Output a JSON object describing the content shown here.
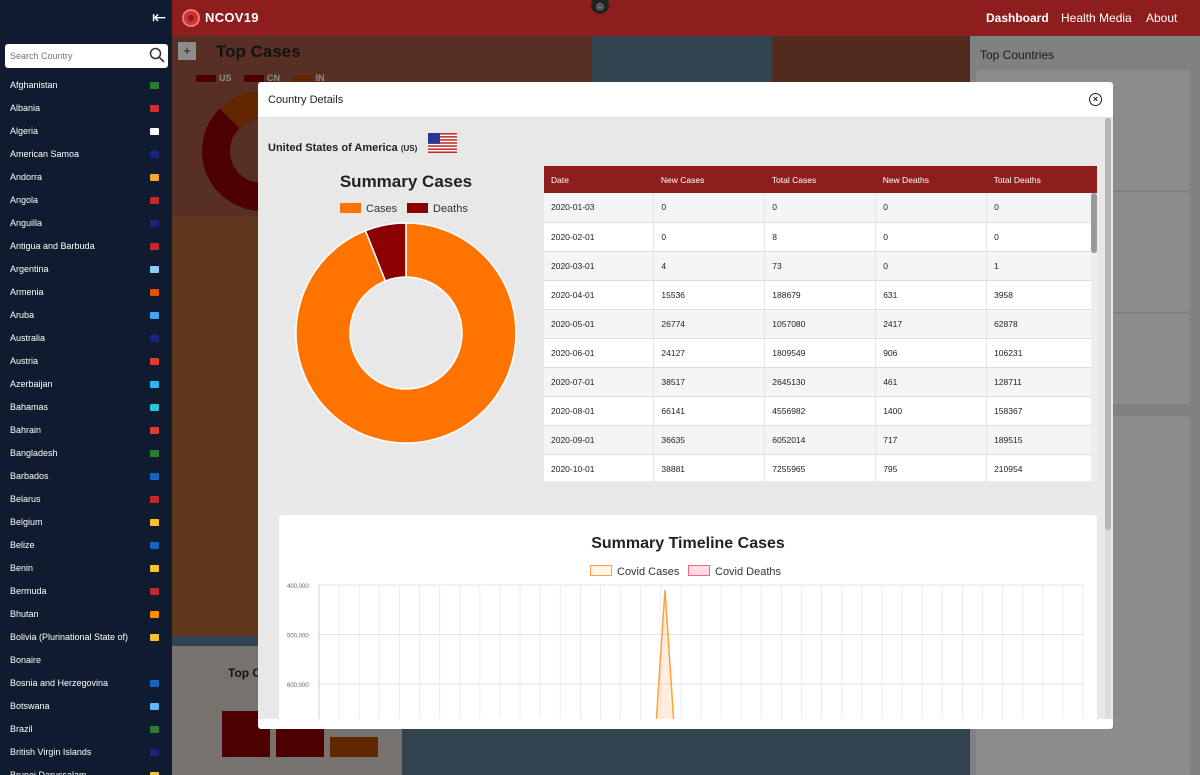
{
  "app": {
    "brand": "NCOV19",
    "nav": {
      "dashboard": "Dashboard",
      "health_media": "Health Media",
      "about": "About"
    }
  },
  "sidebar": {
    "search_placeholder": "Search Country",
    "countries": [
      {
        "name": "Afghanistan",
        "flag": "#2e7d32"
      },
      {
        "name": "Albania",
        "flag": "#d32f2f"
      },
      {
        "name": "Algeria",
        "flag": "#ffffff"
      },
      {
        "name": "American Samoa",
        "flag": "#1a237e"
      },
      {
        "name": "Andorra",
        "flag": "#f9a825"
      },
      {
        "name": "Angola",
        "flag": "#c62828"
      },
      {
        "name": "Anguilla",
        "flag": "#1a237e"
      },
      {
        "name": "Antigua and Barbuda",
        "flag": "#c62828"
      },
      {
        "name": "Argentina",
        "flag": "#90caf9"
      },
      {
        "name": "Armenia",
        "flag": "#e65100"
      },
      {
        "name": "Aruba",
        "flag": "#42a5f5"
      },
      {
        "name": "Australia",
        "flag": "#1a237e"
      },
      {
        "name": "Austria",
        "flag": "#e53935"
      },
      {
        "name": "Azerbaijan",
        "flag": "#29b6f6"
      },
      {
        "name": "Bahamas",
        "flag": "#26c6da"
      },
      {
        "name": "Bahrain",
        "flag": "#e53935"
      },
      {
        "name": "Bangladesh",
        "flag": "#2e7d32"
      },
      {
        "name": "Barbados",
        "flag": "#1565c0"
      },
      {
        "name": "Belarus",
        "flag": "#c62828"
      },
      {
        "name": "Belgium",
        "flag": "#fbc02d"
      },
      {
        "name": "Belize",
        "flag": "#1565c0"
      },
      {
        "name": "Benin",
        "flag": "#fbc02d"
      },
      {
        "name": "Bermuda",
        "flag": "#c62828"
      },
      {
        "name": "Bhutan",
        "flag": "#ff8f00"
      },
      {
        "name": "Bolivia (Plurinational State of)",
        "flag": "#fbc02d"
      },
      {
        "name": "Bonaire",
        "flag": ""
      },
      {
        "name": "Bosnia and Herzegovina",
        "flag": "#1565c0"
      },
      {
        "name": "Botswana",
        "flag": "#64b5f6"
      },
      {
        "name": "Brazil",
        "flag": "#2e7d32"
      },
      {
        "name": "British Virgin Islands",
        "flag": "#1a237e"
      },
      {
        "name": "Brunei Darussalam",
        "flag": "#fbc02d"
      }
    ]
  },
  "background": {
    "map_zoom_in": "+",
    "top_cases_title": "Top Cases",
    "legend": [
      "US",
      "CN",
      "IN"
    ],
    "right_panel_title": "Top Countries",
    "bottom_card_title": "Top C"
  },
  "modal": {
    "title": "Country Details",
    "country_name": "United States of America",
    "country_code": "(US)",
    "summary_title": "Summary Cases",
    "legend": [
      {
        "label": "Cases",
        "color": "#ff7400"
      },
      {
        "label": "Deaths",
        "color": "#8b0000"
      }
    ],
    "table": {
      "headers": [
        "Date",
        "New Cases",
        "Total Cases",
        "New Deaths",
        "Total Deaths"
      ],
      "rows": [
        [
          "2020-01-03",
          "0",
          "0",
          "0",
          "0"
        ],
        [
          "2020-02-01",
          "0",
          "8",
          "0",
          "0"
        ],
        [
          "2020-03-01",
          "4",
          "73",
          "0",
          "1"
        ],
        [
          "2020-04-01",
          "15536",
          "188679",
          "631",
          "3958"
        ],
        [
          "2020-05-01",
          "26774",
          "1057080",
          "2417",
          "62878"
        ],
        [
          "2020-06-01",
          "24127",
          "1809549",
          "906",
          "106231"
        ],
        [
          "2020-07-01",
          "38517",
          "2645130",
          "461",
          "128711"
        ],
        [
          "2020-08-01",
          "66141",
          "4556982",
          "1400",
          "158367"
        ],
        [
          "2020-09-01",
          "36635",
          "6052014",
          "717",
          "189515"
        ],
        [
          "2020-10-01",
          "38881",
          "7255965",
          "795",
          "210954"
        ]
      ]
    },
    "timeline": {
      "title": "Summary Timeline Cases",
      "legend": [
        {
          "label": "Covid Cases",
          "color": "#ff9f40"
        },
        {
          "label": "Covid Deaths",
          "color": "#ff6384"
        }
      ],
      "y_ticks": [
        "600,000",
        "500,000",
        "400,000"
      ]
    }
  },
  "chart_data": [
    {
      "type": "pie",
      "title": "Summary Cases",
      "categories": [
        "Cases",
        "Deaths"
      ],
      "values": [
        94,
        6
      ],
      "colors": [
        "#ff7400",
        "#8b0000"
      ],
      "legend": "top"
    },
    {
      "type": "line",
      "title": "Summary Timeline Cases",
      "series": [
        {
          "name": "Covid Cases",
          "color": "#ff9f40"
        },
        {
          "name": "Covid Deaths",
          "color": "#ff6384"
        }
      ],
      "visible_ylim": [
        360000,
        600000
      ],
      "y_ticks": [
        400000,
        500000,
        600000
      ],
      "peak_value": 590000,
      "grid": true,
      "legend": "top"
    }
  ]
}
